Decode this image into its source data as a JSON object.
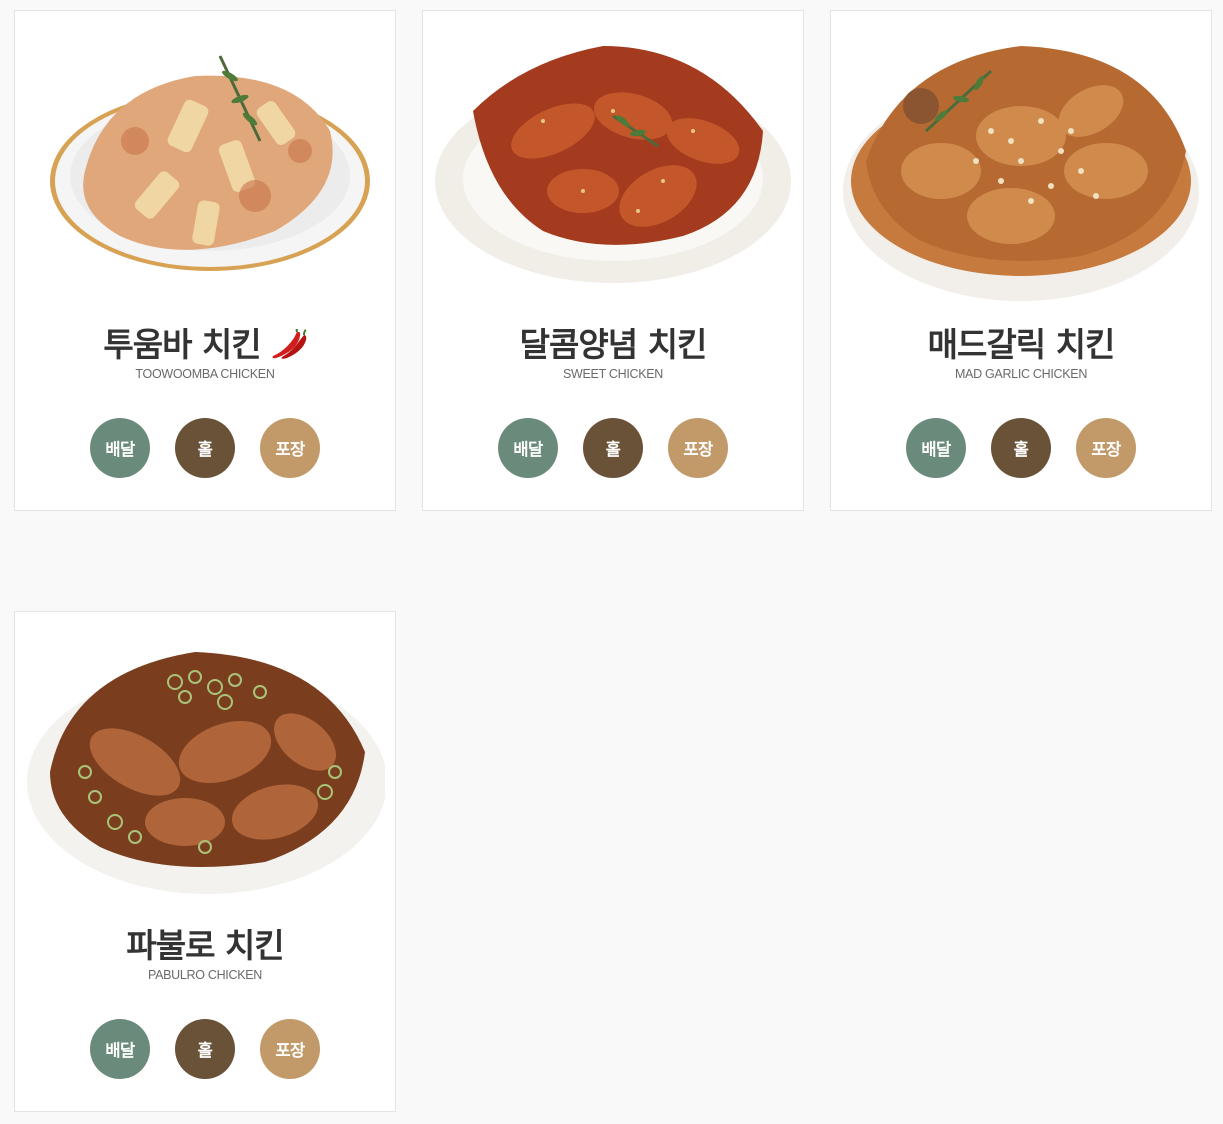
{
  "colors": {
    "delivery": "#6a8b7b",
    "hall": "#6a5238",
    "takeout": "#c29a69",
    "title": "#333333"
  },
  "menu": [
    {
      "name": "투움바 치킨",
      "sub": "TOOWOOMBA CHICKEN",
      "icon": "chili-pepper-icon",
      "image": "toowoomba-chicken-photo",
      "buttons": {
        "delivery": "배달",
        "hall": "홀",
        "takeout": "포장"
      }
    },
    {
      "name": "달콤양념 치킨",
      "sub": "SWEET CHICKEN",
      "image": "sweet-chicken-photo",
      "buttons": {
        "delivery": "배달",
        "hall": "홀",
        "takeout": "포장"
      }
    },
    {
      "name": "매드갈릭 치킨",
      "sub": "MAD GARLIC CHICKEN",
      "image": "mad-garlic-chicken-photo",
      "buttons": {
        "delivery": "배달",
        "hall": "홀",
        "takeout": "포장"
      }
    },
    {
      "name": "파불로 치킨",
      "sub": "PABULRO CHICKEN",
      "image": "pabulro-chicken-photo",
      "buttons": {
        "delivery": "배달",
        "hall": "홀",
        "takeout": "포장"
      }
    }
  ]
}
